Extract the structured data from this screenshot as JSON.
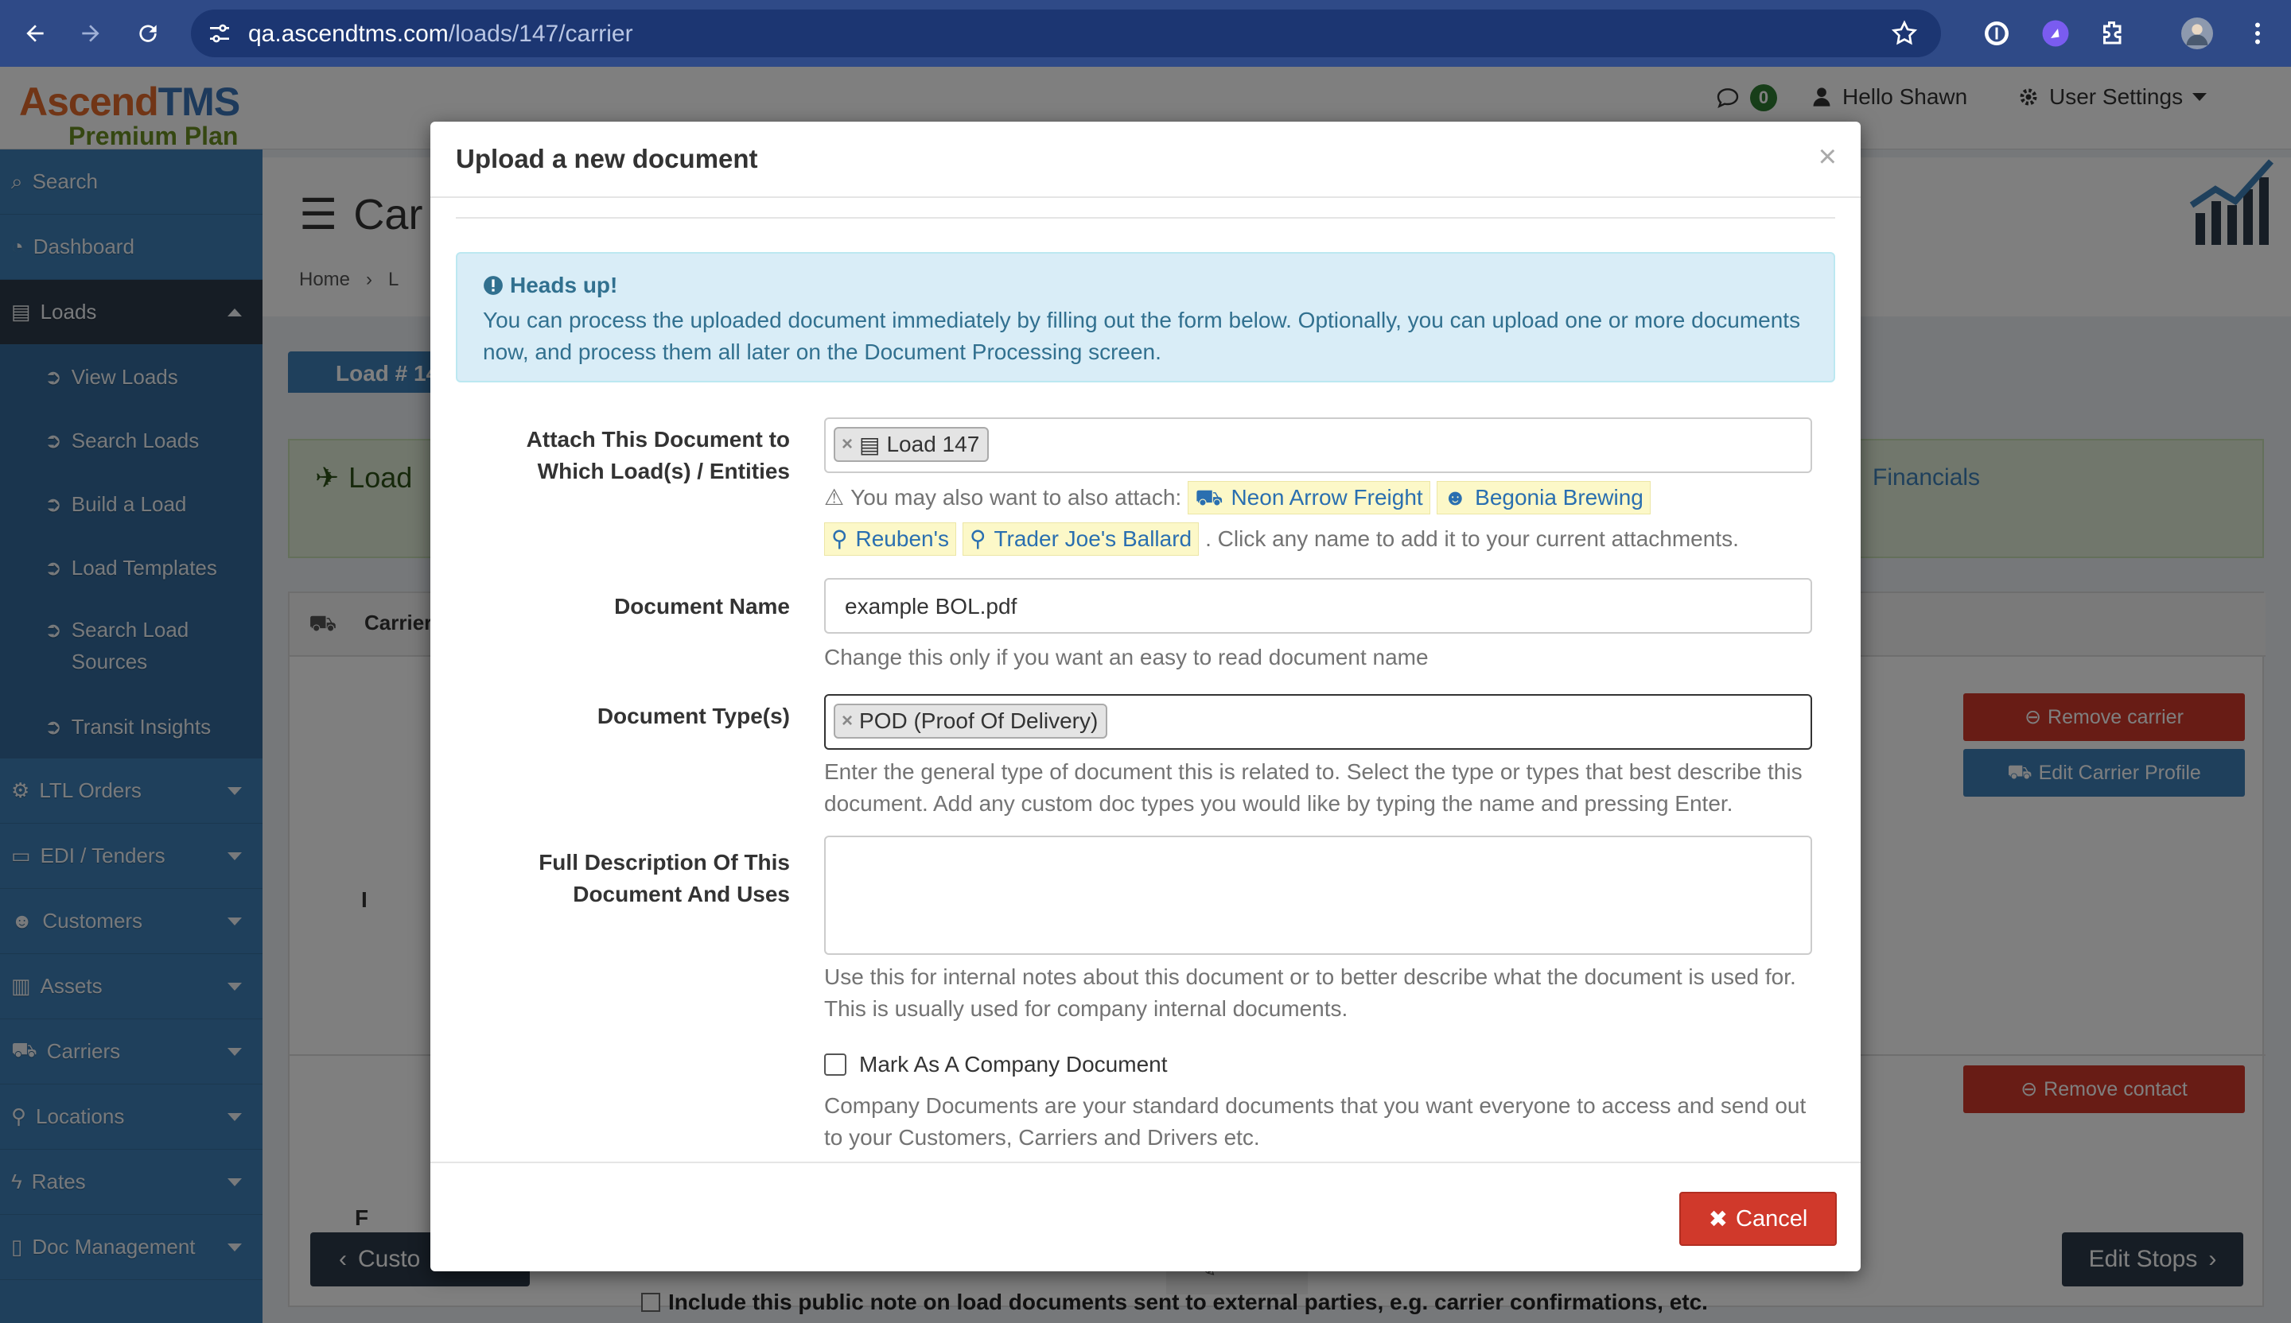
{
  "browser": {
    "url_host": "qa.ascendtms.com",
    "url_path": "/loads/147/carrier"
  },
  "app": {
    "brand_main": "Ascend",
    "brand_accent": "TMS",
    "brand_plan": "Premium Plan",
    "messages_count": "0",
    "greeting": "Hello Shawn",
    "user_settings": "User Settings"
  },
  "sidebar": {
    "items": [
      {
        "label": "Search",
        "icon": "search-icon"
      },
      {
        "label": "Dashboard",
        "icon": "dashboard-icon"
      },
      {
        "label": "Loads",
        "icon": "loads-icon"
      },
      {
        "label": "View Loads",
        "icon": "circle-arrow-icon"
      },
      {
        "label": "Search Loads",
        "icon": "circle-arrow-icon"
      },
      {
        "label": "Build a Load",
        "icon": "circle-arrow-icon"
      },
      {
        "label": "Load Templates",
        "icon": "circle-arrow-icon"
      },
      {
        "label": "Search Load Sources",
        "icon": "circle-arrow-icon"
      },
      {
        "label": "Transit Insights",
        "icon": "circle-arrow-icon"
      },
      {
        "label": "LTL Orders",
        "icon": "ltl-icon"
      },
      {
        "label": "EDI / Tenders",
        "icon": "inbox-icon"
      },
      {
        "label": "Customers",
        "icon": "users-icon"
      },
      {
        "label": "Assets",
        "icon": "barcode-icon"
      },
      {
        "label": "Carriers",
        "icon": "truck-icon"
      },
      {
        "label": "Locations",
        "icon": "pin-icon"
      },
      {
        "label": "Rates",
        "icon": "bolt-icon"
      },
      {
        "label": "Doc Management",
        "icon": "doc-icon"
      }
    ]
  },
  "background": {
    "page_title": "Car",
    "breadcrumb_home": "Home",
    "breadcrumb_next": "L",
    "load_tab": "Load # 14",
    "section_load": "Load",
    "financials": "Financials",
    "carrier_col": "Carrier",
    "remove_carrier": "Remove carrier",
    "edit_carrier_profile": "Edit Carrier Profile",
    "remove_contact": "Remove contact",
    "back_button": "Custo",
    "edit_stops": "Edit Stops",
    "public_note": "Include this public note on load documents sent to external parties, e.g. carrier confirmations, etc.",
    "row_letter_1": "I",
    "row_letter_2": "F"
  },
  "modal": {
    "title": "Upload a new document",
    "close": "×",
    "alert_title": "Heads up!",
    "alert_body": "You can process the uploaded document immediately by filling out the form below. Optionally, you can upload one or more documents now, and process them all later on the Document Processing screen.",
    "attach_label_1": "Attach This Document to",
    "attach_label_2": "Which Load(s) / Entities",
    "attach_tag": "Load 147",
    "suggest_prefix": "You may also want to also attach:",
    "suggestions": [
      {
        "label": "Neon Arrow Freight",
        "icon": "truck-icon"
      },
      {
        "label": "Begonia Brewing",
        "icon": "users-icon"
      },
      {
        "label": "Reuben's",
        "icon": "pin-icon"
      },
      {
        "label": "Trader Joe's Ballard",
        "icon": "pin-icon"
      }
    ],
    "suggest_suffix": ". Click any name to add it to your current attachments.",
    "doc_name_label": "Document Name",
    "doc_name_value": "example BOL.pdf",
    "doc_name_help": "Change this only if you want an easy to read document name",
    "doc_type_label": "Document Type(s)",
    "doc_type_tag": "POD (Proof Of Delivery)",
    "doc_type_help": "Enter the general type of document this is related to. Select the type or types that best describe this document. Add any custom doc types you would like by typing the name and pressing Enter.",
    "desc_label_1": "Full Description Of This",
    "desc_label_2": "Document And Uses",
    "desc_value": "",
    "desc_help": "Use this for internal notes about this document or to better describe what the document is used for. This is usually used for company internal documents.",
    "company_doc_label": "Mark As A Company Document",
    "company_doc_checked": false,
    "company_doc_help": "Company Documents are your standard documents that you want everyone to access and send out to your Customers, Carriers and Drivers etc.",
    "cancel": "Cancel"
  },
  "colors": {
    "browser_bar": "#2f4a87",
    "sidebar": "#3f80b8",
    "alert_bg": "#d9edf7",
    "cancel_red": "#d0392b",
    "chip_yellow": "#fcf8c8"
  }
}
